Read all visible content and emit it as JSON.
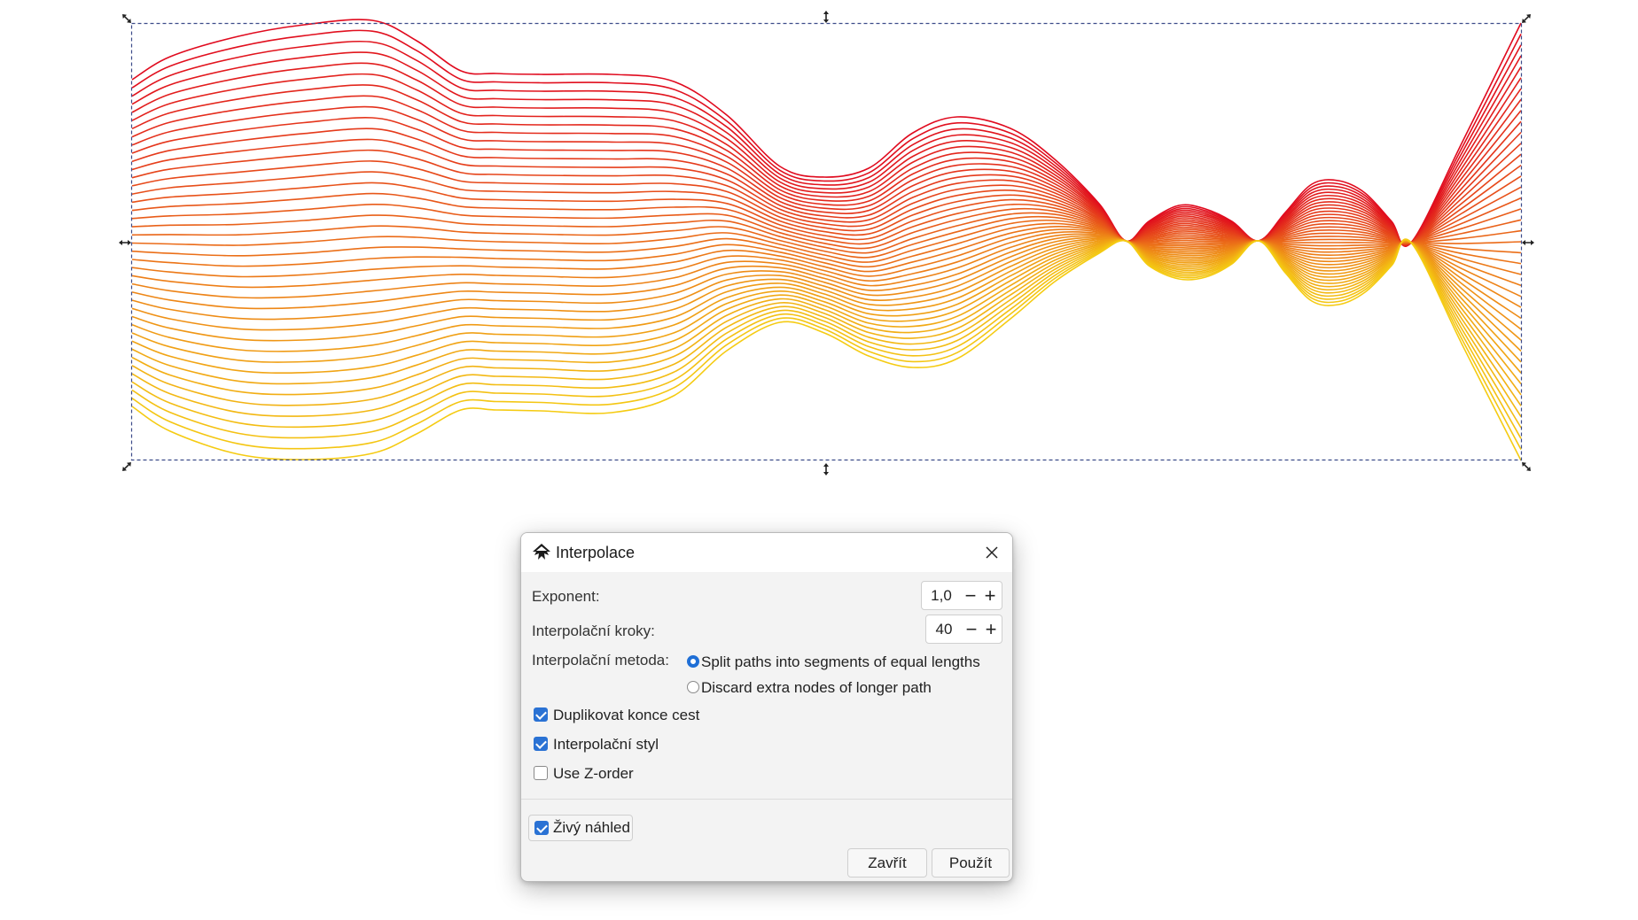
{
  "canvas": {
    "line_count": 40,
    "gradient_colors": [
      "#e00a1e",
      "#f5cb12"
    ]
  },
  "dialog": {
    "title": "Interpolace",
    "icon": "inkscape-icon",
    "close_icon": "close-icon",
    "exponent": {
      "label": "Exponent:",
      "value": "1,0"
    },
    "steps": {
      "label": "Interpolační kroky:",
      "value": "40"
    },
    "method": {
      "label": "Interpolační metoda:",
      "options": [
        {
          "label": "Split paths into segments of equal lengths",
          "selected": true
        },
        {
          "label": "Discard extra nodes of longer path",
          "selected": false
        }
      ]
    },
    "checkboxes": [
      {
        "label": "Duplikovat konce cest",
        "checked": true
      },
      {
        "label": "Interpolační styl",
        "checked": true
      },
      {
        "label": "Use Z-order",
        "checked": false
      }
    ],
    "live_preview": {
      "label": "Živý náhled",
      "checked": true
    },
    "buttons": {
      "close": "Zavřít",
      "apply": "Použít"
    },
    "accent_color": "#1f6fd6"
  }
}
